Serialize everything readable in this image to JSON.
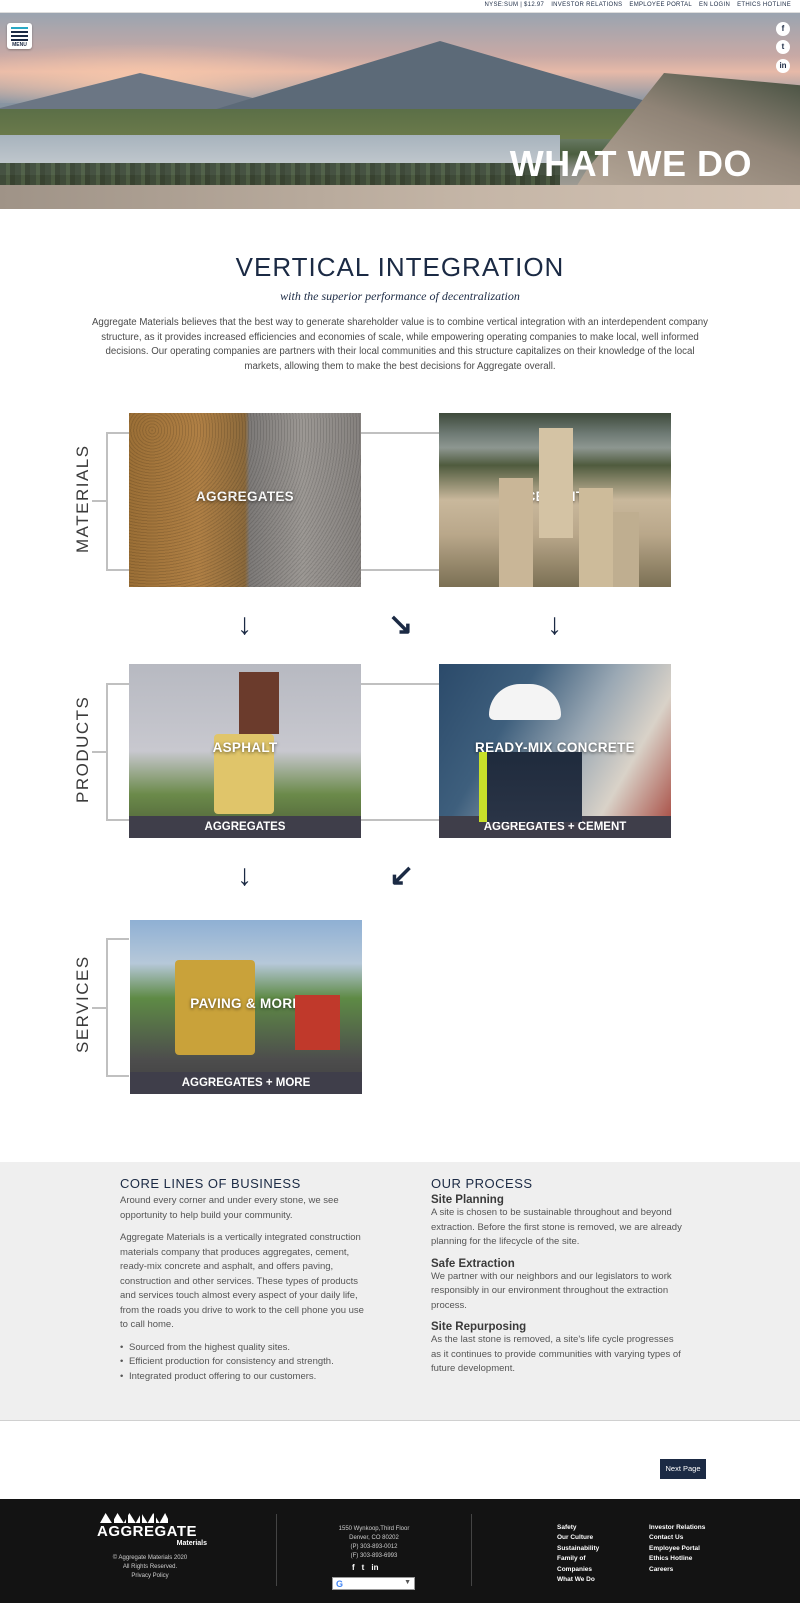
{
  "topbar": {
    "links": [
      "NYSE:SUM | $12.97",
      "INVESTOR RELATIONS",
      "EMPLOYEE PORTAL",
      "EN LOGIN",
      "ETHICS HOTLINE"
    ]
  },
  "hero": {
    "title": "WHAT WE DO",
    "menu_label": "MENU",
    "social": [
      "facebook-icon",
      "twitter-icon",
      "linkedin-icon"
    ]
  },
  "intro": {
    "heading": "VERTICAL INTEGRATION",
    "subheading": "with the superior performance of decentralization",
    "body": "Aggregate Materials believes that the best way to generate shareholder value is to combine vertical integration with an interdependent company structure, as it provides increased efficiencies and economies of scale, while empowering operating companies to make local, well informed decisions. Our operating companies are partners with their local communities and this structure capitalizes on their knowledge of the local markets, allowing them to make the best decisions for Aggregate overall."
  },
  "diagram": {
    "materials_label": "MATERIALS",
    "products_label": "PRODUCTS",
    "services_label": "SERVICES",
    "tiles": {
      "aggregates": {
        "title": "AGGREGATES"
      },
      "cement": {
        "title": "CEMENT"
      },
      "asphalt": {
        "title": "ASPHALT",
        "foot": "AGGREGATES"
      },
      "readymix": {
        "title": "READY-MIX CONCRETE",
        "foot": "AGGREGATES + CEMENT"
      },
      "paving": {
        "title": "PAVING & MORE",
        "foot": "AGGREGATES + MORE"
      }
    },
    "arrows": {
      "down": "↓",
      "down_right": "↘",
      "down_left": "↙"
    }
  },
  "core": {
    "heading": "CORE LINES OF BUSINESS",
    "p1": "Around every corner and under every stone, we see opportunity to help build your community.",
    "p2": "Aggregate Materials is a vertically integrated construction materials company that produces aggregates, cement, ready-mix concrete and asphalt, and offers paving, construction and other services. These types of products and services touch almost every aspect of your daily life, from the roads you drive to work to the cell phone you use to call home.",
    "bullets": [
      "Sourced from the highest quality sites.",
      "Efficient production for consistency and strength.",
      "Integrated product offering to our customers."
    ]
  },
  "process": {
    "heading": "OUR PROCESS",
    "steps": [
      {
        "title": "Site Planning",
        "text": "A site is chosen to be sustainable throughout and beyond extraction. Before the first stone is removed, we are already planning for the lifecycle of the site."
      },
      {
        "title": "Safe Extraction",
        "text": "We partner with our neighbors and our legislators to work responsibly in our environment throughout the extraction process."
      },
      {
        "title": "Site Repurposing",
        "text": "As the last stone is removed, a site's life cycle progresses as it continues to provide communities with varying types of future development."
      }
    ]
  },
  "next_page": "Next Page",
  "footer": {
    "logo_word": "AGGREGATE",
    "logo_sub": "Materials",
    "copyright": [
      "© Aggregate Materials 2020",
      "All Rights Reserved.",
      "Privacy Policy"
    ],
    "address": [
      "1550 Wynkoop,Third Floor",
      "Denver, CO 80202",
      "(P) 303-893-0012",
      "(F) 303-893-6993"
    ],
    "links_col1": [
      "Safety",
      "Our Culture",
      "Sustainability",
      "Family of",
      "Companies",
      "What We Do"
    ],
    "links_col2": [
      "Investor Relations",
      "Contact Us",
      "Employee Portal",
      "Ethics Hotline",
      "Careers"
    ],
    "translate_icon": "G",
    "social": [
      "f",
      "t",
      "in"
    ]
  }
}
